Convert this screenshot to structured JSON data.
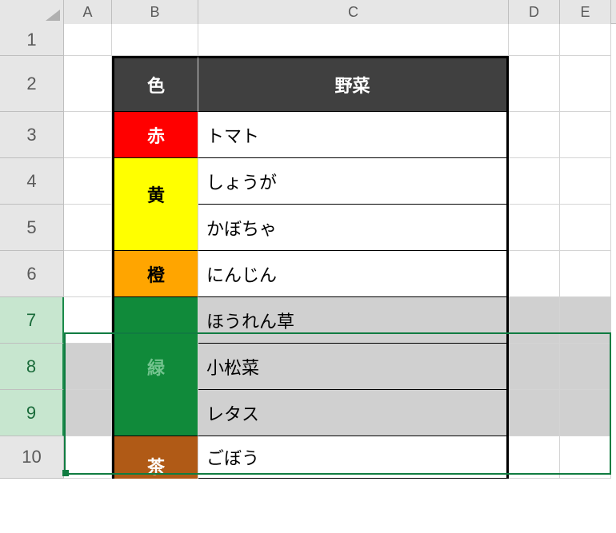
{
  "columns": {
    "A": "A",
    "B": "B",
    "C": "C",
    "D": "D",
    "E": "E"
  },
  "rowNumbers": {
    "r1": "1",
    "r2": "2",
    "r3": "3",
    "r4": "4",
    "r5": "5",
    "r6": "6",
    "r7": "7",
    "r8": "8",
    "r9": "9",
    "r10": "10"
  },
  "header": {
    "color": "色",
    "vegetable": "野菜"
  },
  "rows": {
    "r3": {
      "color": "赤",
      "veg": "トマト",
      "bg": "#ff0000"
    },
    "r4": {
      "color": "黄",
      "veg": "しょうが",
      "bg": "#ffff00"
    },
    "r5": {
      "color": "黄",
      "veg": "かぼちゃ",
      "bg": "#ffff00"
    },
    "r6": {
      "color": "橙",
      "veg": "にんじん",
      "bg": "#ffa500"
    },
    "r7": {
      "color": "緑",
      "veg": "ほうれん草",
      "bg": "#108a3a"
    },
    "r8": {
      "color": "緑",
      "veg": "小松菜",
      "bg": "#108a3a"
    },
    "r9": {
      "color": "緑",
      "veg": "レタス",
      "bg": "#108a3a"
    },
    "r10": {
      "color": "茶",
      "veg": "ごぼう",
      "bg": "#b05a16"
    }
  },
  "mergedGroups": [
    {
      "color": "黄",
      "rows": [
        "r4",
        "r5"
      ]
    },
    {
      "color": "緑",
      "rows": [
        "r7",
        "r8",
        "r9"
      ]
    }
  ],
  "selection": {
    "rows": [
      "7",
      "8",
      "9"
    ],
    "range": "7:9"
  }
}
